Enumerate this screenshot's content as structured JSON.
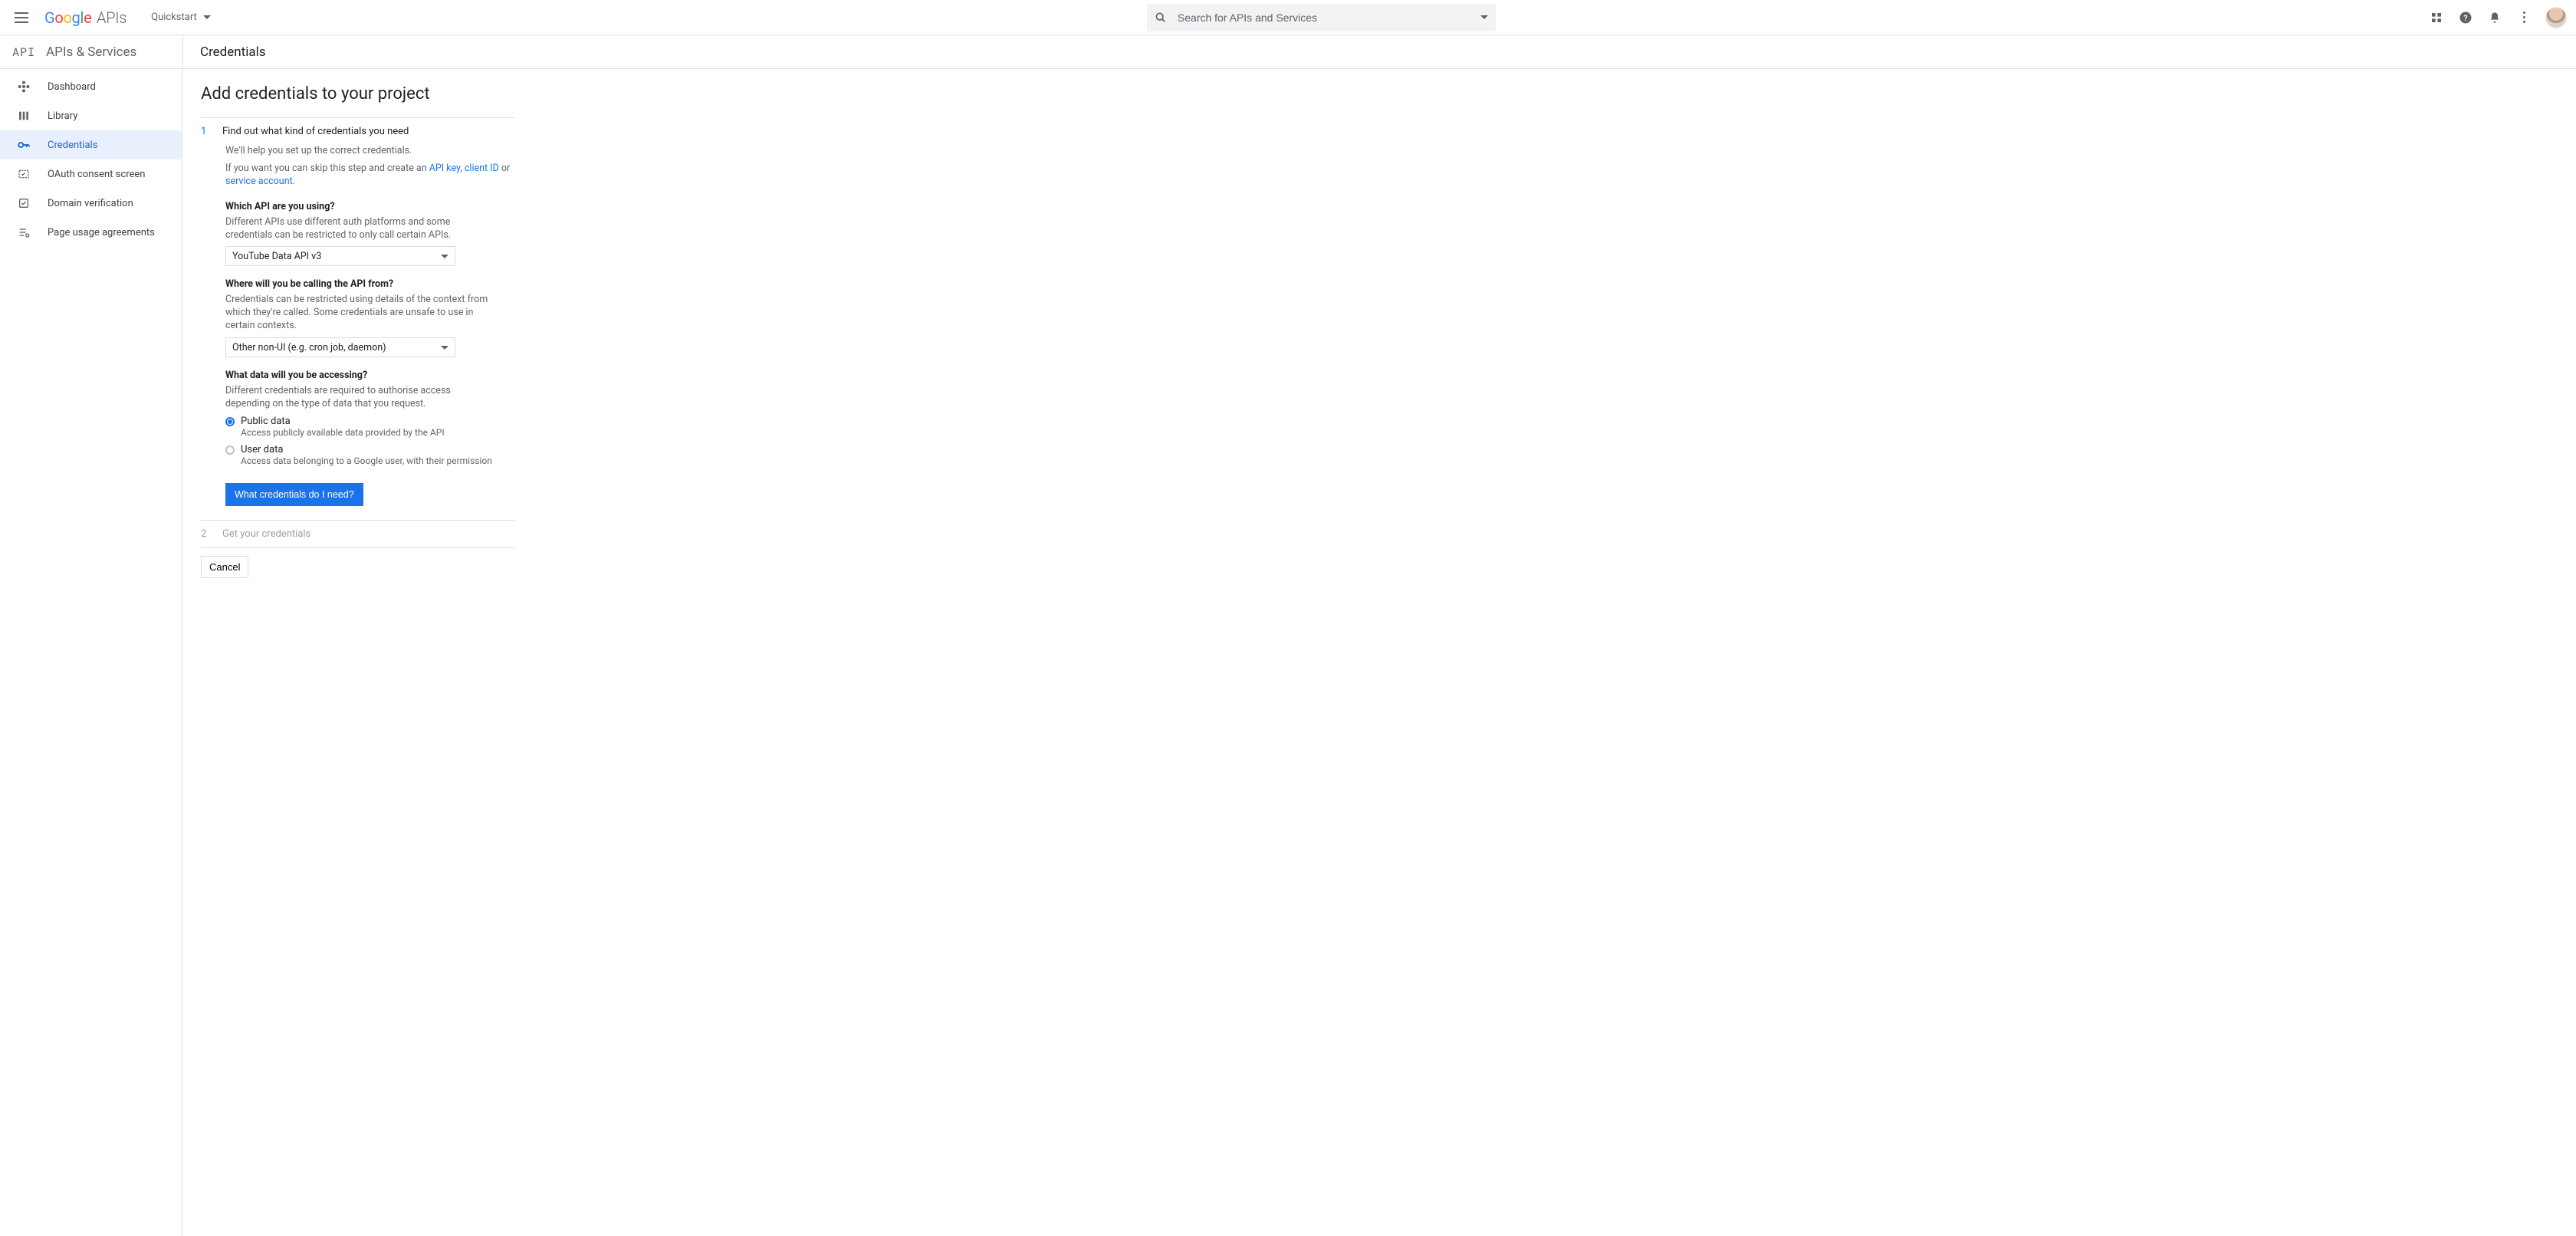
{
  "header": {
    "logo_text": "Google",
    "logo_suffix": "APIs",
    "project_name": "Quickstart",
    "search_placeholder": "Search for APIs and Services"
  },
  "subheader": {
    "section_glyph": "API",
    "section_title": "APIs & Services",
    "page_title": "Credentials"
  },
  "sidebar": {
    "items": [
      {
        "label": "Dashboard"
      },
      {
        "label": "Library"
      },
      {
        "label": "Credentials"
      },
      {
        "label": "OAuth consent screen"
      },
      {
        "label": "Domain verification"
      },
      {
        "label": "Page usage agreements"
      }
    ]
  },
  "content": {
    "title": "Add credentials to your project",
    "step1": {
      "num": "1",
      "title": "Find out what kind of credentials you need",
      "help1": "We'll help you set up the correct credentials.",
      "help2_pre": "If you want you can skip this step and create an ",
      "help2_link_api": "API key",
      "help2_sep1": ", ",
      "help2_link_client": "client ID",
      "help2_sep2": " or ",
      "help2_link_service": "service account",
      "help2_post": ".",
      "q1": {
        "title": "Which API are you using?",
        "desc": "Different APIs use different auth platforms and some credentials can be restricted to only call certain APIs.",
        "value": "YouTube Data API v3"
      },
      "q2": {
        "title": "Where will you be calling the API from?",
        "desc": "Credentials can be restricted using details of the context from which they're called. Some credentials are unsafe to use in certain contexts.",
        "value": "Other non-UI (e.g. cron job, daemon)"
      },
      "q3": {
        "title": "What data will you be accessing?",
        "desc": "Different credentials are required to authorise access depending on the type of data that you request.",
        "opt1_label": "Public data",
        "opt1_sub": "Access publicly available data provided by the API",
        "opt2_label": "User data",
        "opt2_sub": "Access data belonging to a Google user, with their permission"
      },
      "cta": "What credentials do I need?"
    },
    "step2": {
      "num": "2",
      "title": "Get your credentials"
    },
    "cancel": "Cancel"
  }
}
